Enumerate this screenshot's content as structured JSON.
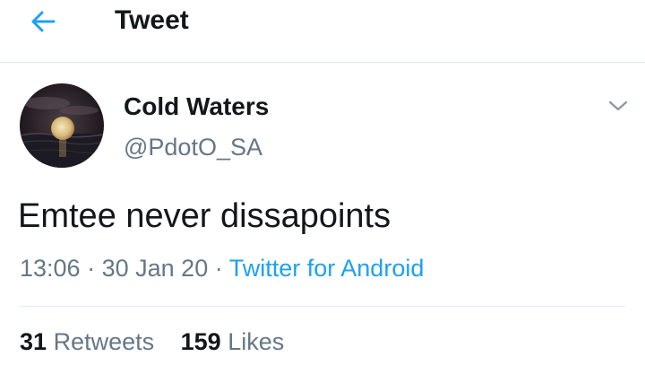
{
  "header": {
    "title": "Tweet",
    "back_icon": "arrow-left-icon"
  },
  "tweet": {
    "author": {
      "display_name": "Cold Waters",
      "handle": "@PdotO_SA",
      "avatar": "moon-over-water-avatar"
    },
    "text": "Emtee never dissapoints",
    "time": "13:06",
    "date": "30 Jan 20",
    "separator": "·",
    "source": "Twitter for Android",
    "menu_icon": "chevron-down-icon"
  },
  "stats": {
    "retweets_count": "31",
    "retweets_label": "Retweets",
    "likes_count": "159",
    "likes_label": "Likes"
  },
  "colors": {
    "accent": "#1da1f2",
    "text_primary": "#14171a",
    "text_secondary": "#657786",
    "divider": "#e1e8ed"
  }
}
